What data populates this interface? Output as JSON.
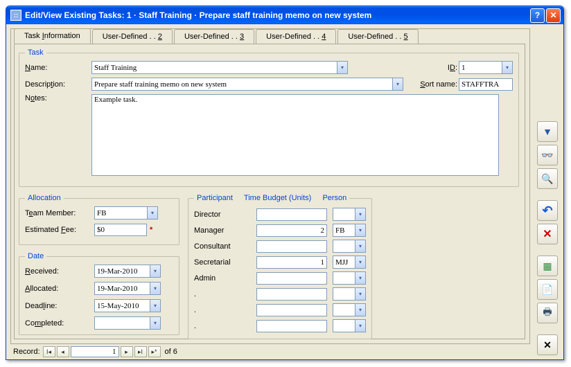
{
  "window": {
    "title": "Edit/View Existing Tasks:  1  ·  Staff Training  ·  Prepare staff training memo on new system"
  },
  "tabs": [
    {
      "label_html": "Task <u>I</u>nformation",
      "text": "Task Information"
    },
    {
      "label_html": "User-Defined . . <u>2</u>",
      "text": "User-Defined . . 2"
    },
    {
      "label_html": "User-Defined . . <u>3</u>",
      "text": "User-Defined . . 3"
    },
    {
      "label_html": "User-Defined . . <u>4</u>",
      "text": "User-Defined . . 4"
    },
    {
      "label_html": "User-Defined . . <u>5</u>",
      "text": "User-Defined . . 5"
    }
  ],
  "task_group": {
    "legend": "Task",
    "name_label_html": "<u>N</u>ame:",
    "name_value": "Staff Training",
    "id_label_html": "I<u>D</u>:",
    "id_value": "1",
    "desc_label_html": "Descrip<u>t</u>ion:",
    "desc_value": "Prepare staff training memo on new system",
    "sort_label_html": "<u>S</u>ort name:",
    "sort_value": "STAFFTRA",
    "notes_label_html": "N<u>o</u>tes:",
    "notes_value": "Example task."
  },
  "allocation_group": {
    "legend": "Allocation",
    "team_label_html": "T<u>e</u>am Member:",
    "team_value": "FB",
    "fee_label_html": "Estimated <u>F</u>ee:",
    "fee_value": "$0"
  },
  "participants_group": {
    "legend_participant": "Participant",
    "legend_budget": "Time Budget (Units)",
    "legend_person": "Person",
    "rows": [
      {
        "role": "Director",
        "budget": "",
        "person": ""
      },
      {
        "role": "Manager",
        "budget": "2",
        "person": "FB"
      },
      {
        "role": "Consultant",
        "budget": "",
        "person": ""
      },
      {
        "role": "Secretarial",
        "budget": "1",
        "person": "MJJ"
      },
      {
        "role": "Admin",
        "budget": "",
        "person": ""
      },
      {
        "role": ".",
        "budget": "",
        "person": ""
      },
      {
        "role": ".",
        "budget": "",
        "person": ""
      },
      {
        "role": ".",
        "budget": "",
        "person": ""
      }
    ]
  },
  "date_group": {
    "legend": "Date",
    "received_label_html": "<u>R</u>eceived:",
    "received_value": "19-Mar-2010",
    "allocated_label_html": "<u>A</u>llocated:",
    "allocated_value": "19-Mar-2010",
    "deadline_label_html": "Dead<u>l</u>ine:",
    "deadline_value": "15-May-2010",
    "completed_label_html": "Co<u>m</u>pleted:",
    "completed_value": ""
  },
  "record_nav": {
    "label": "Record:",
    "current": "1",
    "of_text": "of  6"
  },
  "sidebar_icons": {
    "filter": "▼",
    "find": "🔎",
    "search": "🔍",
    "undo": "↶",
    "delete": "✕",
    "spreadsheet": "▦",
    "preview": "📄",
    "print": "🖶",
    "close": "✕"
  }
}
